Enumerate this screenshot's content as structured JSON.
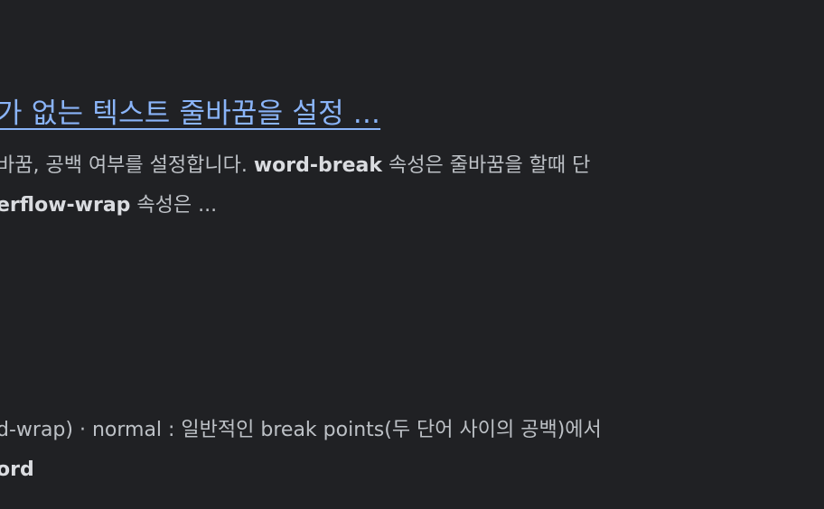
{
  "result1": {
    "title": "가 없는 텍스트 줄바꿈을 설정 ...",
    "snippet_line1_pre": "바꿈, 공백 여부를 설정합니다. ",
    "snippet_line1_bold": "word-break",
    "snippet_line1_post": " 속성은 줄바꿈을 할때 단",
    "snippet_line2_bold": "erflow-wrap",
    "snippet_line2_post": " 속성은 ..."
  },
  "result2": {
    "snippet_line1": "d-wrap) · normal : 일반적인 break points(두 단어 사이의 공백)에서",
    "snippet_line2_bold": "ord"
  }
}
